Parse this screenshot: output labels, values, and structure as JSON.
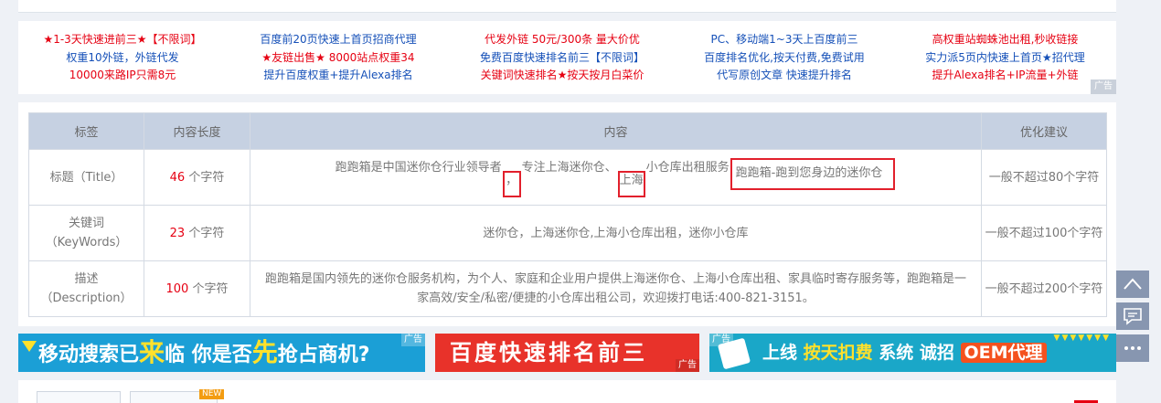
{
  "ads": {
    "col1": [
      "★1-3天快速进前三★【不限词】",
      "权重10外链，外链代发",
      "10000来路IP只需8元"
    ],
    "col2": [
      "百度前20页快速上首页招商代理",
      "★友链出售★ 8000站点权重34",
      "提升百度权重+提升Alexa排名"
    ],
    "col3": [
      "代发外链  50元/300条  量大价优",
      "免费百度快速排名前三【不限词】",
      "关键词快速排名★按天按月白菜价"
    ],
    "col4": [
      "PC、移动端1~3天上百度前三",
      "百度排名优化,按天付费,免费试用",
      "代写原创文章  快速提升排名"
    ],
    "col5": [
      "高权重站蜘蛛池出租,秒收链接",
      "实力派5页内快速上首页★招代理",
      "提升Alexa排名+IP流量+外链"
    ],
    "badge": "广告"
  },
  "table": {
    "headers": [
      "标签",
      "内容长度",
      "内容",
      "优化建议"
    ],
    "rows": [
      {
        "label_line1": "标题（Title）",
        "label_line2": "",
        "length_num": "46",
        "length_unit": "个字符",
        "content_part1": "跑跑箱是中国迷你仓行业领导者",
        "content_hl1": "，",
        "content_part2": "专注上海迷你仓、",
        "content_hl2": "上海",
        "content_part3": "小仓库出租服务",
        "content_hl3": "跑跑箱-跑到您身边的迷你仓",
        "advice": "一般不超过80个字符"
      },
      {
        "label_line1": "关键词",
        "label_line2": "（KeyWords）",
        "length_num": "23",
        "length_unit": "个字符",
        "content": "迷你仓，上海迷你仓,上海小仓库出租，迷你小仓库",
        "advice": "一般不超过100个字符"
      },
      {
        "label_line1": "描述",
        "label_line2": "（Description）",
        "length_num": "100",
        "length_unit": "个字符",
        "content": "跑跑箱是国内领先的迷你仓服务机构，为个人、家庭和企业用户提供上海迷你仓、上海小仓库出租、家具临时寄存服务等，跑跑箱是一家高效/安全/私密/便捷的小仓库出租公司，欢迎拨打电话:400-821-3151。",
        "advice": "一般不超过200个字符"
      }
    ]
  },
  "banners": {
    "b1_part1": "移动搜索已",
    "b1_big1": "来",
    "b1_part2": "临 你是否",
    "b1_big2": "先",
    "b1_part3": "抢占商机?",
    "b2_text": "百度快速排名前三",
    "b3_part1": "上线 ",
    "b3_green": "按天扣费",
    "b3_part2": " 系统 诚招 ",
    "b3_oem": "OEM代理",
    "ad_label": "广告"
  },
  "bottom": {
    "new_badge": "NEW"
  },
  "colors": {
    "accent_red": "#e60012",
    "link_blue": "#1550b8",
    "table_header": "#c6d1e2",
    "side_button": "#8796b0"
  },
  "icons": [
    "back-to-top-icon",
    "feedback-chat-icon",
    "more-dots-icon"
  ]
}
